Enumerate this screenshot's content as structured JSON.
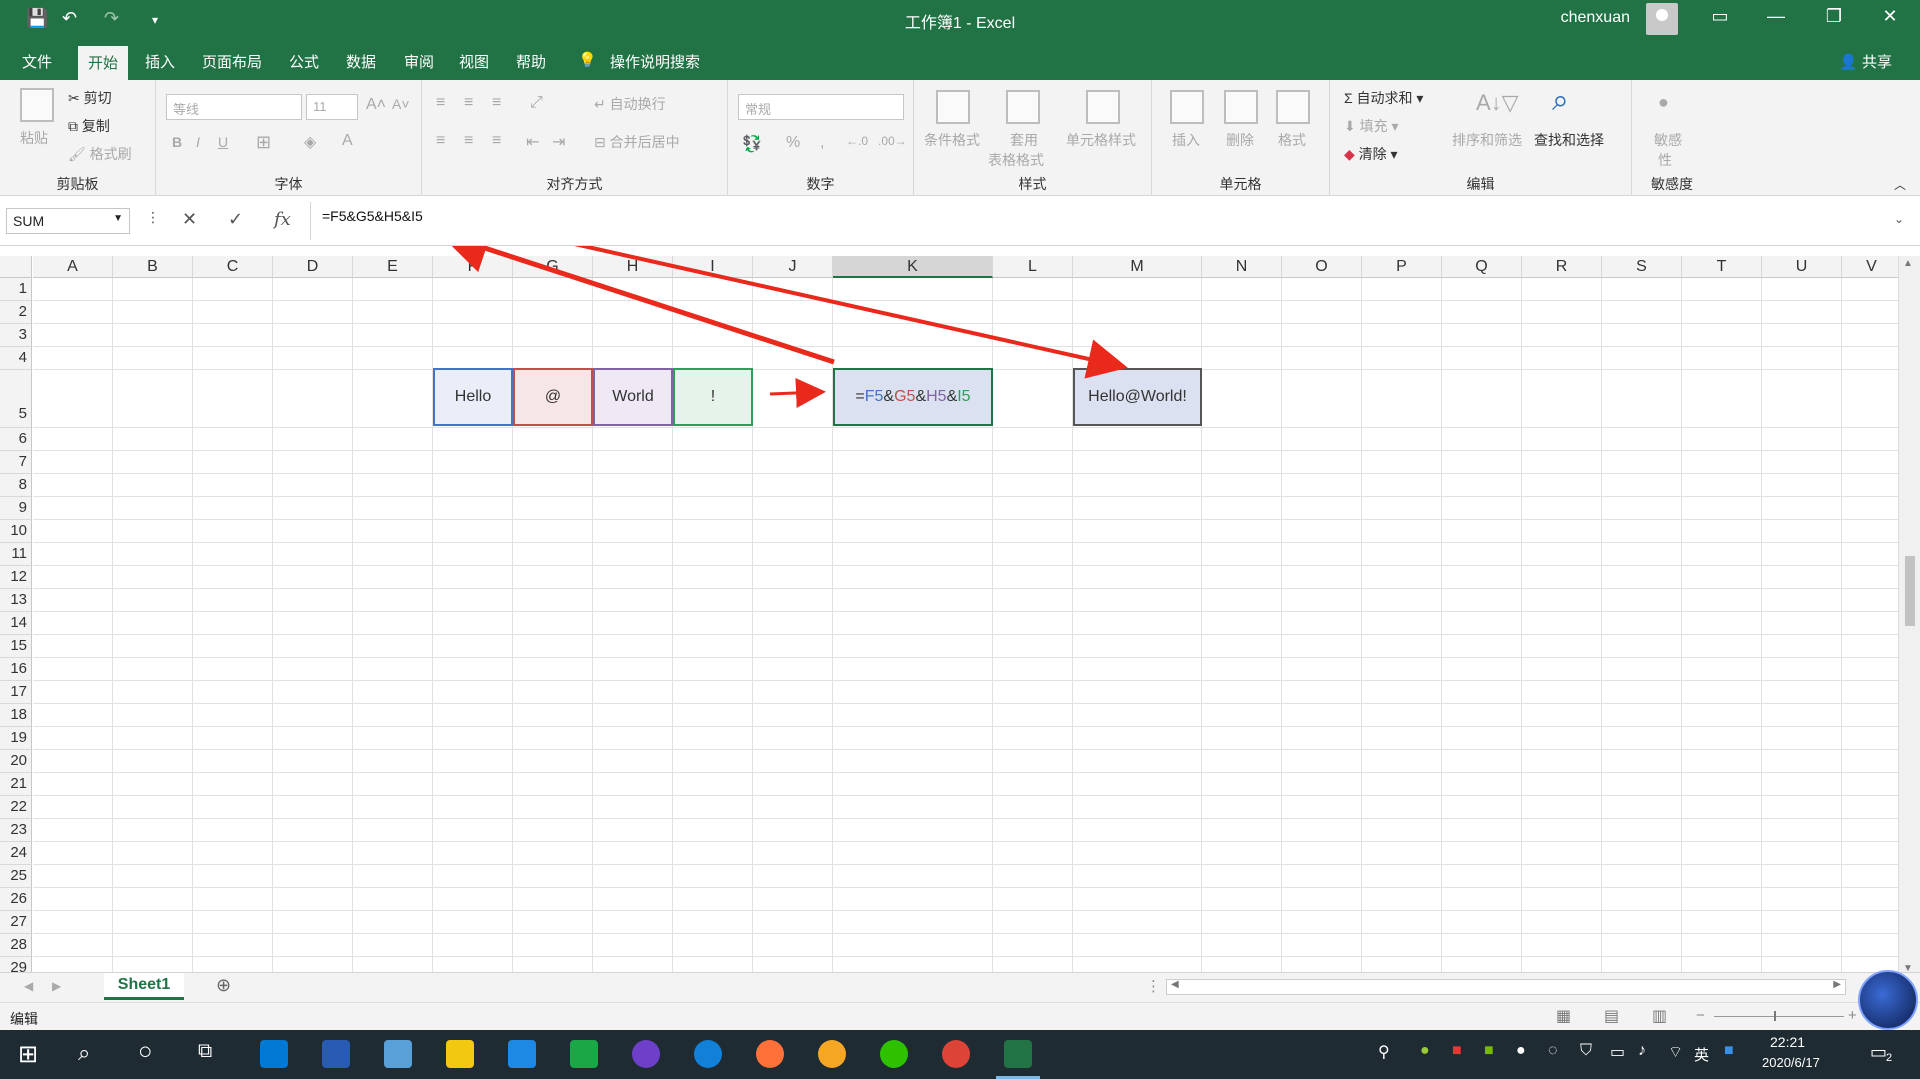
{
  "window": {
    "title": "工作簿1  -  Excel",
    "user": "chenxuan"
  },
  "tabs": [
    "文件",
    "开始",
    "插入",
    "页面布局",
    "公式",
    "数据",
    "审阅",
    "视图",
    "帮助",
    "操作说明搜索"
  ],
  "share_label": "共享",
  "ribbon": {
    "clipboard": {
      "paste": "粘贴",
      "cut": "剪切",
      "copy": "复制",
      "format_painter": "格式刷",
      "label": "剪贴板"
    },
    "font": {
      "name": "等线",
      "size": "11",
      "label": "字体"
    },
    "align": {
      "wrap": "自动换行",
      "merge": "合并后居中",
      "label": "对齐方式"
    },
    "number": {
      "format": "常规",
      "label": "数字"
    },
    "styles": {
      "conditional": "条件格式",
      "table_line1": "套用",
      "table_line2": "表格格式",
      "cell_styles": "单元格样式",
      "label": "样式"
    },
    "cells": {
      "insert": "插入",
      "delete": "删除",
      "format": "格式",
      "label": "单元格"
    },
    "editing": {
      "autosum": "自动求和",
      "fill": "填充",
      "clear": "清除",
      "sort": "排序和筛选",
      "find": "查找和选择",
      "label": "编辑"
    },
    "sensitivity": {
      "line1": "敏感",
      "line2": "性",
      "label": "敏感度"
    }
  },
  "formula_bar": {
    "name_box": "SUM",
    "formula": "=F5&G5&H5&I5",
    "fx": "fx"
  },
  "columns": [
    "A",
    "B",
    "C",
    "D",
    "E",
    "F",
    "G",
    "H",
    "I",
    "J",
    "K",
    "L",
    "M",
    "N",
    "O",
    "P",
    "Q",
    "R",
    "S",
    "T",
    "U",
    "V"
  ],
  "rows": [
    "1",
    "2",
    "3",
    "4",
    "5",
    "6",
    "7",
    "8",
    "9",
    "10",
    "11",
    "12",
    "13",
    "14",
    "15",
    "16",
    "17",
    "18",
    "19",
    "20",
    "21",
    "22",
    "23",
    "24",
    "25",
    "26",
    "27",
    "28",
    "29"
  ],
  "cells": {
    "F5": "Hello",
    "G5": "@",
    "H5": "World",
    "I5": "!",
    "K5_parts": [
      "=",
      "F5",
      "&",
      "G5",
      "&",
      "H5",
      "&",
      "I5"
    ],
    "M5": "Hello@World!"
  },
  "colors": {
    "excel_green": "#217346",
    "arrow_red": "#e8291c",
    "F_ref": "#4472c4",
    "G_ref": "#c0504d",
    "H_ref": "#8064a2",
    "I_ref": "#2e9e5b"
  },
  "sheet_tab": "Sheet1",
  "status": {
    "mode": "编辑"
  },
  "clock": {
    "time": "22:21",
    "date": "2020/6/17"
  },
  "tray": {
    "ime": "英",
    "notifications": "2"
  }
}
